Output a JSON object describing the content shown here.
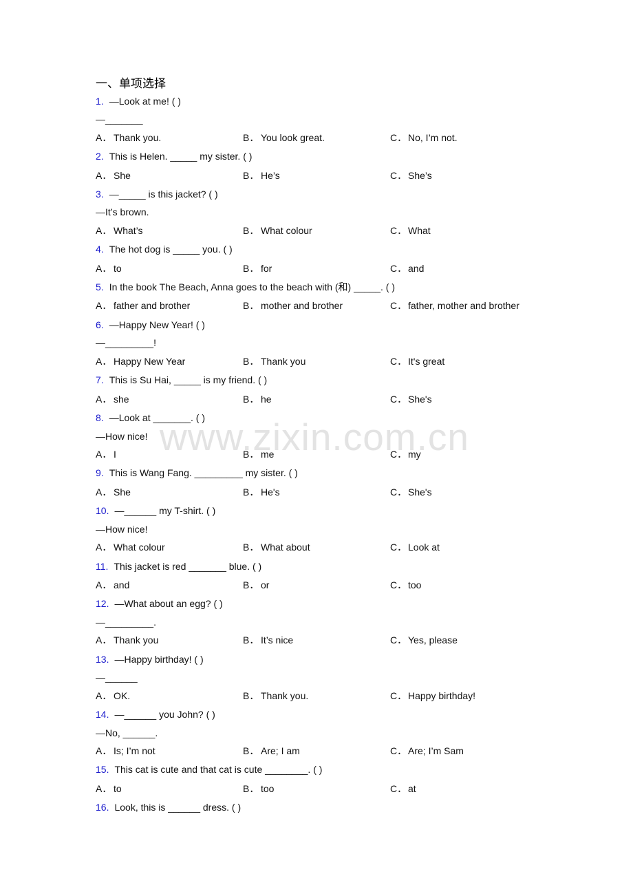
{
  "section_title": "一、单项选择",
  "watermark": "www.zixin.com.cn",
  "questions": [
    {
      "num": "1.",
      "stem": "—Look at me! (   )",
      "extra": [
        "—_______"
      ],
      "options": {
        "A": "Thank you.",
        "B": "You look great.",
        "C": "No, I’m not."
      }
    },
    {
      "num": "2.",
      "stem": "This is Helen. _____ my sister. (    )",
      "extra": [],
      "options": {
        "A": "She",
        "B": "He’s",
        "C": "She’s"
      }
    },
    {
      "num": "3.",
      "stem": "—_____ is this jacket? (    )",
      "extra": [
        "—It’s brown."
      ],
      "options": {
        "A": "What’s",
        "B": "What colour",
        "C": "What"
      }
    },
    {
      "num": "4.",
      "stem": "The hot dog is _____ you. (    )",
      "extra": [],
      "options": {
        "A": "to",
        "B": "for",
        "C": "and"
      }
    },
    {
      "num": "5.",
      "stem": "In the book The Beach, Anna goes to the beach with (和) _____. (    )",
      "extra": [],
      "options": {
        "A": "father and brother",
        "B": "mother and brother",
        "C": "father, mother and brother"
      }
    },
    {
      "num": "6.",
      "stem": "—Happy New Year! (   )",
      "extra": [
        "—_________!"
      ],
      "options": {
        "A": "Happy New Year",
        "B": "Thank you",
        "C": "It's great"
      }
    },
    {
      "num": "7.",
      "stem": "This is Su Hai, _____ is my friend. (     )",
      "extra": [],
      "options": {
        "A": "she",
        "B": "he",
        "C": "She's"
      }
    },
    {
      "num": "8.",
      "stem": "—Look at _______. (   )",
      "extra": [
        "—How nice!"
      ],
      "options": {
        "A": "I",
        "B": "me",
        "C": "my"
      }
    },
    {
      "num": "9.",
      "stem": "This is Wang Fang. _________ my sister. (    )",
      "extra": [],
      "options": {
        "A": "She",
        "B": "He's",
        "C": "She's"
      }
    },
    {
      "num": "10.",
      "stem": "—______ my T-shirt. (   )",
      "extra": [
        "—How nice!"
      ],
      "options": {
        "A": "What colour",
        "B": "What about",
        "C": "Look at"
      }
    },
    {
      "num": "11.",
      "stem": "This jacket is red _______ blue. (   )",
      "extra": [],
      "options": {
        "A": "and",
        "B": "or",
        "C": "too"
      }
    },
    {
      "num": "12.",
      "stem": "—What about an egg? (    )",
      "extra": [
        "—_________."
      ],
      "options": {
        "A": "Thank you",
        "B": "It’s nice",
        "C": "Yes, please"
      }
    },
    {
      "num": "13.",
      "stem": "—Happy birthday! (   )",
      "extra": [
        "—______"
      ],
      "options": {
        "A": "OK.",
        "B": "Thank you.",
        "C": "Happy birthday!"
      }
    },
    {
      "num": "14.",
      "stem": "—______ you John? (    )",
      "extra": [
        "—No, ______."
      ],
      "options": {
        "A": "Is; I’m not",
        "B": "Are; I am",
        "C": "Are; I’m Sam"
      }
    },
    {
      "num": "15.",
      "stem": "This cat is cute and that cat is cute ________. (     )",
      "extra": [],
      "options": {
        "A": "to",
        "B": "too",
        "C": "at"
      }
    },
    {
      "num": "16.",
      "stem": "Look, this is ______ dress. (    )",
      "extra": [],
      "options": null
    }
  ],
  "option_labels": {
    "A": "A．",
    "B": "B．",
    "C": "C．"
  }
}
